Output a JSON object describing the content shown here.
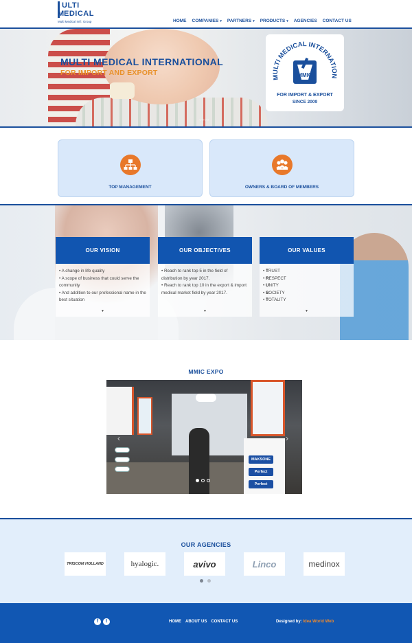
{
  "brand": {
    "logo_line1": "ULTI",
    "logo_line2": "EDICAL",
    "logo_m": "M",
    "logo_tagline": "Multi Medical Int'l. Group"
  },
  "nav": {
    "items": [
      {
        "label": "HOME",
        "dropdown": false
      },
      {
        "label": "COMPANIES",
        "dropdown": true
      },
      {
        "label": "PARTNERS",
        "dropdown": true
      },
      {
        "label": "PRODUCTS",
        "dropdown": true
      },
      {
        "label": "AGENCIES",
        "dropdown": false
      },
      {
        "label": "CONTACT US",
        "dropdown": false
      }
    ],
    "caret": "▾"
  },
  "hero": {
    "title": "MULTI MEDICAL INTERNATIONAL",
    "subtitle": "FOR IMPORT AND EXPORT",
    "badge": {
      "arc_text": "MULTI MEDICAL INTERNATIONAL CO.",
      "center": "MMIC",
      "line1": "FOR IMPORT & EXPORT",
      "line2": "SINCE 2009"
    },
    "dots": "○○○○"
  },
  "features": [
    {
      "label": "TOP MANAGEMENT",
      "icon": "org-chart-icon"
    },
    {
      "label": "OWNERS & BOARD OF MEMBERS",
      "icon": "people-icon"
    }
  ],
  "cards": {
    "vision": {
      "title": "OUR VISION",
      "items": [
        "• A change in life quality",
        "• A scope of business that could serve the community",
        "• And addition to our professional name in the best situation"
      ]
    },
    "objectives": {
      "title": "OUR OBJECTIVES",
      "items": [
        "• Reach to rank top 5 in the field of distribution by year 2017.",
        "• Reach to rank top 10 in the export & import medical market field by year 2017."
      ]
    },
    "values": {
      "title": "OUR VALUES",
      "items": [
        {
          "initial": "T",
          "rest": "RUST"
        },
        {
          "initial": "R",
          "rest": "ESPECT"
        },
        {
          "initial": "U",
          "rest": "NITY"
        },
        {
          "initial": "S",
          "rest": "OCIETY"
        },
        {
          "initial": "T",
          "rest": "OTALITY"
        }
      ]
    },
    "caret": "▼"
  },
  "expo": {
    "title": "MMIC EXPO",
    "signs": [
      "MAKSONE",
      "Perfect",
      "Perfect"
    ],
    "prev": "‹",
    "next": "›",
    "slides": 3,
    "active_slide": 1
  },
  "agencies": {
    "title": "OUR AGENCIES",
    "logos": [
      {
        "name": "TRISCOM HOLLAND",
        "color": "#222222"
      },
      {
        "name": "hyalogic.",
        "color": "#333333"
      },
      {
        "name": "avivo",
        "color": "#111111"
      },
      {
        "name": "Linco",
        "color": "#8fa0b3"
      },
      {
        "name": "medinox",
        "color": "#444444"
      }
    ],
    "active_page": 1
  },
  "footer": {
    "social": [
      {
        "name": "facebook-icon",
        "glyph": "f"
      },
      {
        "name": "twitter-icon",
        "glyph": "t"
      }
    ],
    "links": [
      "HOME",
      "ABOUT US",
      "CONTACT US"
    ],
    "designed_by": "Designed by:",
    "designer": "Idea World Web"
  },
  "colors": {
    "primary": "#1a4f9c",
    "card_head": "#1155b0",
    "accent": "#e8782a",
    "footer": "#1157b3"
  }
}
